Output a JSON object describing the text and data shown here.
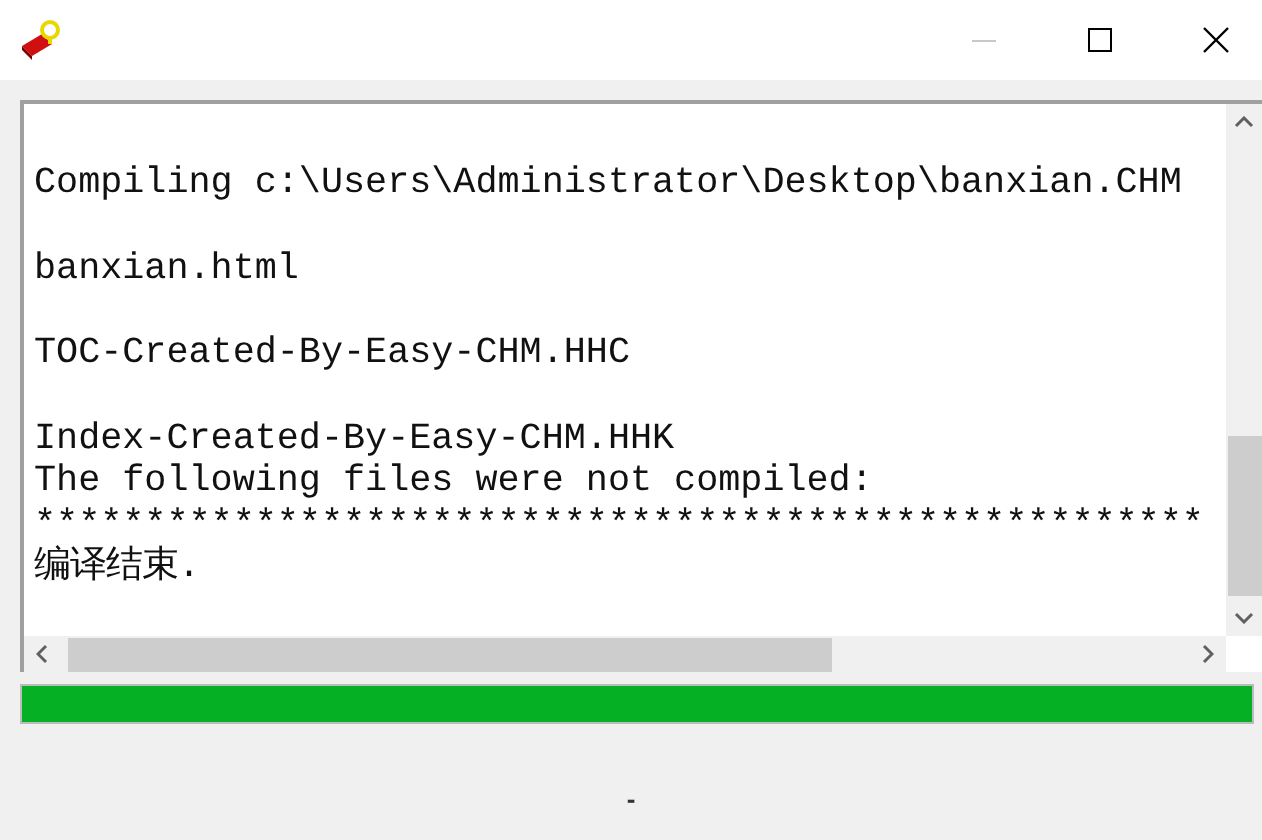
{
  "window": {
    "minimize_disabled": true
  },
  "log": {
    "lines": [
      {
        "text": "Compiling c:\\Users\\Administrator\\Desktop\\banxian.CHM",
        "blank_line_before": true
      },
      {
        "text": "banxian.html",
        "blank_line_before": true
      },
      {
        "text": "TOC-Created-By-Easy-CHM.HHC",
        "blank_line_before": true
      },
      {
        "text": "Index-Created-By-Easy-CHM.HHK",
        "blank_line_before": true
      },
      {
        "text": "The following files were not compiled:",
        "blank_line_before": false
      },
      {
        "text": "*****************************************************",
        "blank_line_before": false
      },
      {
        "text": "编译结束.",
        "blank_line_before": false
      }
    ]
  },
  "progress": {
    "level": 1
  },
  "status_text": "-"
}
